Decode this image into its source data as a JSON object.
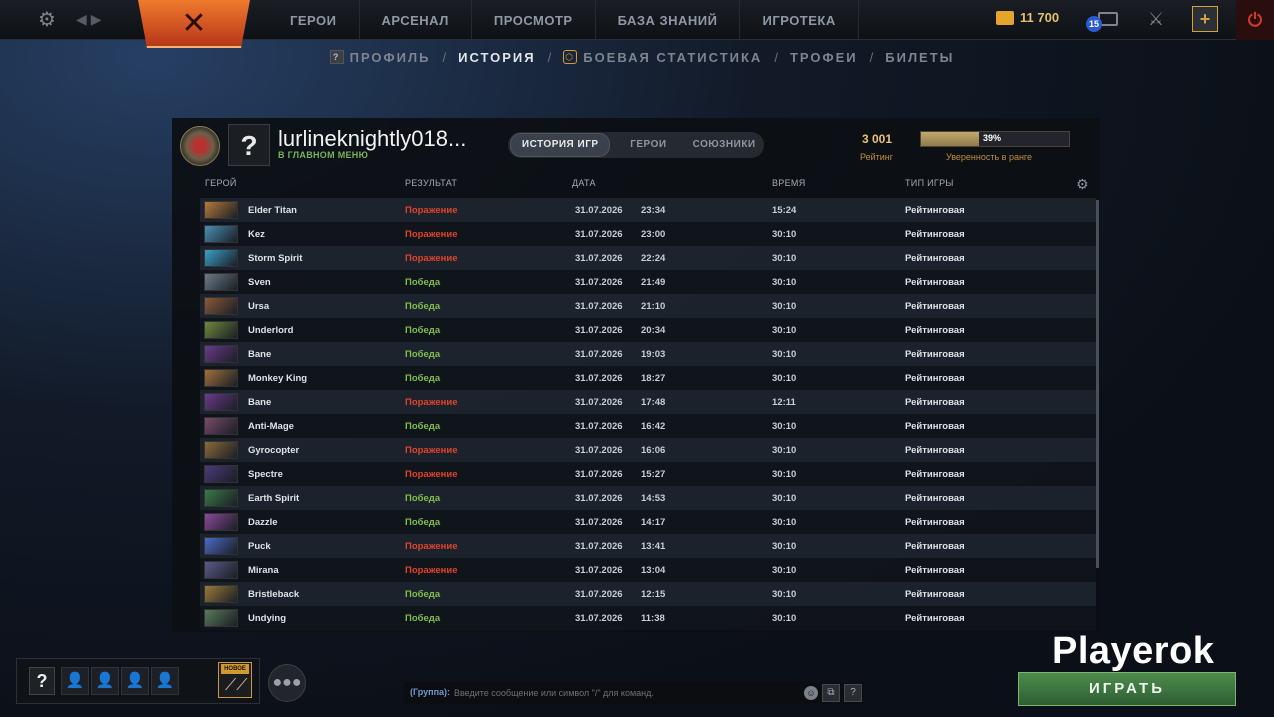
{
  "topbar": {
    "nav": [
      "ГЕРОИ",
      "АРСЕНАЛ",
      "ПРОСМОТР",
      "БАЗА ЗНАНИЙ",
      "ИГРОТЕКА"
    ],
    "gold": "11 700",
    "notifications": "15"
  },
  "subnav": {
    "items": [
      "ПРОФИЛЬ",
      "ИСТОРИЯ",
      "БОЕВАЯ СТАТИСТИКА",
      "ТРОФЕИ",
      "БИЛЕТЫ"
    ],
    "active": "ИСТОРИЯ",
    "separator": "/"
  },
  "profile": {
    "username": "lurlineknightly018...",
    "status": "В ГЛАВНОМ МЕНЮ",
    "avatar": "?",
    "tabs": [
      "ИСТОРИЯ ИГР",
      "ГЕРОИ",
      "СОЮЗНИКИ"
    ],
    "rating_value": "3 001",
    "rating_label": "Рейтинг",
    "confidence_pct": "39%",
    "confidence_fraction": 0.39,
    "confidence_label": "Уверенность в ранге"
  },
  "table": {
    "headers": {
      "hero": "ГЕРОЙ",
      "result": "РЕЗУЛЬТАТ",
      "date": "ДАТА",
      "duration": "ВРЕМЯ",
      "mode": "ТИП ИГРЫ"
    },
    "rows": [
      {
        "hero": "Elder Titan",
        "result": "Поражение",
        "win": false,
        "date": "31.07.2026",
        "time": "23:34",
        "duration": "15:24",
        "mode": "Рейтинговая",
        "color": "#b57a3a"
      },
      {
        "hero": "Kez",
        "result": "Поражение",
        "win": false,
        "date": "31.07.2026",
        "time": "23:00",
        "duration": "30:10",
        "mode": "Рейтинговая",
        "color": "#4a8fb5"
      },
      {
        "hero": "Storm Spirit",
        "result": "Поражение",
        "win": false,
        "date": "31.07.2026",
        "time": "22:24",
        "duration": "30:10",
        "mode": "Рейтинговая",
        "color": "#3aa0c8"
      },
      {
        "hero": "Sven",
        "result": "Победа",
        "win": true,
        "date": "31.07.2026",
        "time": "21:49",
        "duration": "30:10",
        "mode": "Рейтинговая",
        "color": "#6c7a88"
      },
      {
        "hero": "Ursa",
        "result": "Победа",
        "win": true,
        "date": "31.07.2026",
        "time": "21:10",
        "duration": "30:10",
        "mode": "Рейтинговая",
        "color": "#8a5a3a"
      },
      {
        "hero": "Underlord",
        "result": "Победа",
        "win": true,
        "date": "31.07.2026",
        "time": "20:34",
        "duration": "30:10",
        "mode": "Рейтинговая",
        "color": "#6f8a3a"
      },
      {
        "hero": "Bane",
        "result": "Победа",
        "win": true,
        "date": "31.07.2026",
        "time": "19:03",
        "duration": "30:10",
        "mode": "Рейтинговая",
        "color": "#6a3a8a"
      },
      {
        "hero": "Monkey King",
        "result": "Победа",
        "win": true,
        "date": "31.07.2026",
        "time": "18:27",
        "duration": "30:10",
        "mode": "Рейтинговая",
        "color": "#a0703a"
      },
      {
        "hero": "Bane",
        "result": "Поражение",
        "win": false,
        "date": "31.07.2026",
        "time": "17:48",
        "duration": "12:11",
        "mode": "Рейтинговая",
        "color": "#6a3a8a"
      },
      {
        "hero": "Anti-Mage",
        "result": "Победа",
        "win": true,
        "date": "31.07.2026",
        "time": "16:42",
        "duration": "30:10",
        "mode": "Рейтинговая",
        "color": "#7a4a6a"
      },
      {
        "hero": "Gyrocopter",
        "result": "Поражение",
        "win": false,
        "date": "31.07.2026",
        "time": "16:06",
        "duration": "30:10",
        "mode": "Рейтинговая",
        "color": "#8a6a3a"
      },
      {
        "hero": "Spectre",
        "result": "Поражение",
        "win": false,
        "date": "31.07.2026",
        "time": "15:27",
        "duration": "30:10",
        "mode": "Рейтинговая",
        "color": "#4a3a7a"
      },
      {
        "hero": "Earth Spirit",
        "result": "Победа",
        "win": true,
        "date": "31.07.2026",
        "time": "14:53",
        "duration": "30:10",
        "mode": "Рейтинговая",
        "color": "#3a7a4a"
      },
      {
        "hero": "Dazzle",
        "result": "Победа",
        "win": true,
        "date": "31.07.2026",
        "time": "14:17",
        "duration": "30:10",
        "mode": "Рейтинговая",
        "color": "#8a4a9a"
      },
      {
        "hero": "Puck",
        "result": "Поражение",
        "win": false,
        "date": "31.07.2026",
        "time": "13:41",
        "duration": "30:10",
        "mode": "Рейтинговая",
        "color": "#4a6ac8"
      },
      {
        "hero": "Mirana",
        "result": "Поражение",
        "win": false,
        "date": "31.07.2026",
        "time": "13:04",
        "duration": "30:10",
        "mode": "Рейтинговая",
        "color": "#5a5a8a"
      },
      {
        "hero": "Bristleback",
        "result": "Победа",
        "win": true,
        "date": "31.07.2026",
        "time": "12:15",
        "duration": "30:10",
        "mode": "Рейтинговая",
        "color": "#9a7a3a"
      },
      {
        "hero": "Undying",
        "result": "Победа",
        "win": true,
        "date": "31.07.2026",
        "time": "11:38",
        "duration": "30:10",
        "mode": "Рейтинговая",
        "color": "#5a7a5a"
      }
    ]
  },
  "bottom": {
    "party_help": "?",
    "new_label": "НОВОЕ",
    "chat_prefix": "(Группа):",
    "chat_placeholder": "Введите сообщение или символ \"/\" для команд.",
    "chat_help": "?",
    "brand": "Playerok",
    "play_label": "ИГРАТЬ"
  },
  "colors": {
    "win": "#7fbf4a",
    "loss": "#e0432a",
    "accent": "#e5c06a",
    "play": "#4e8c4c"
  }
}
